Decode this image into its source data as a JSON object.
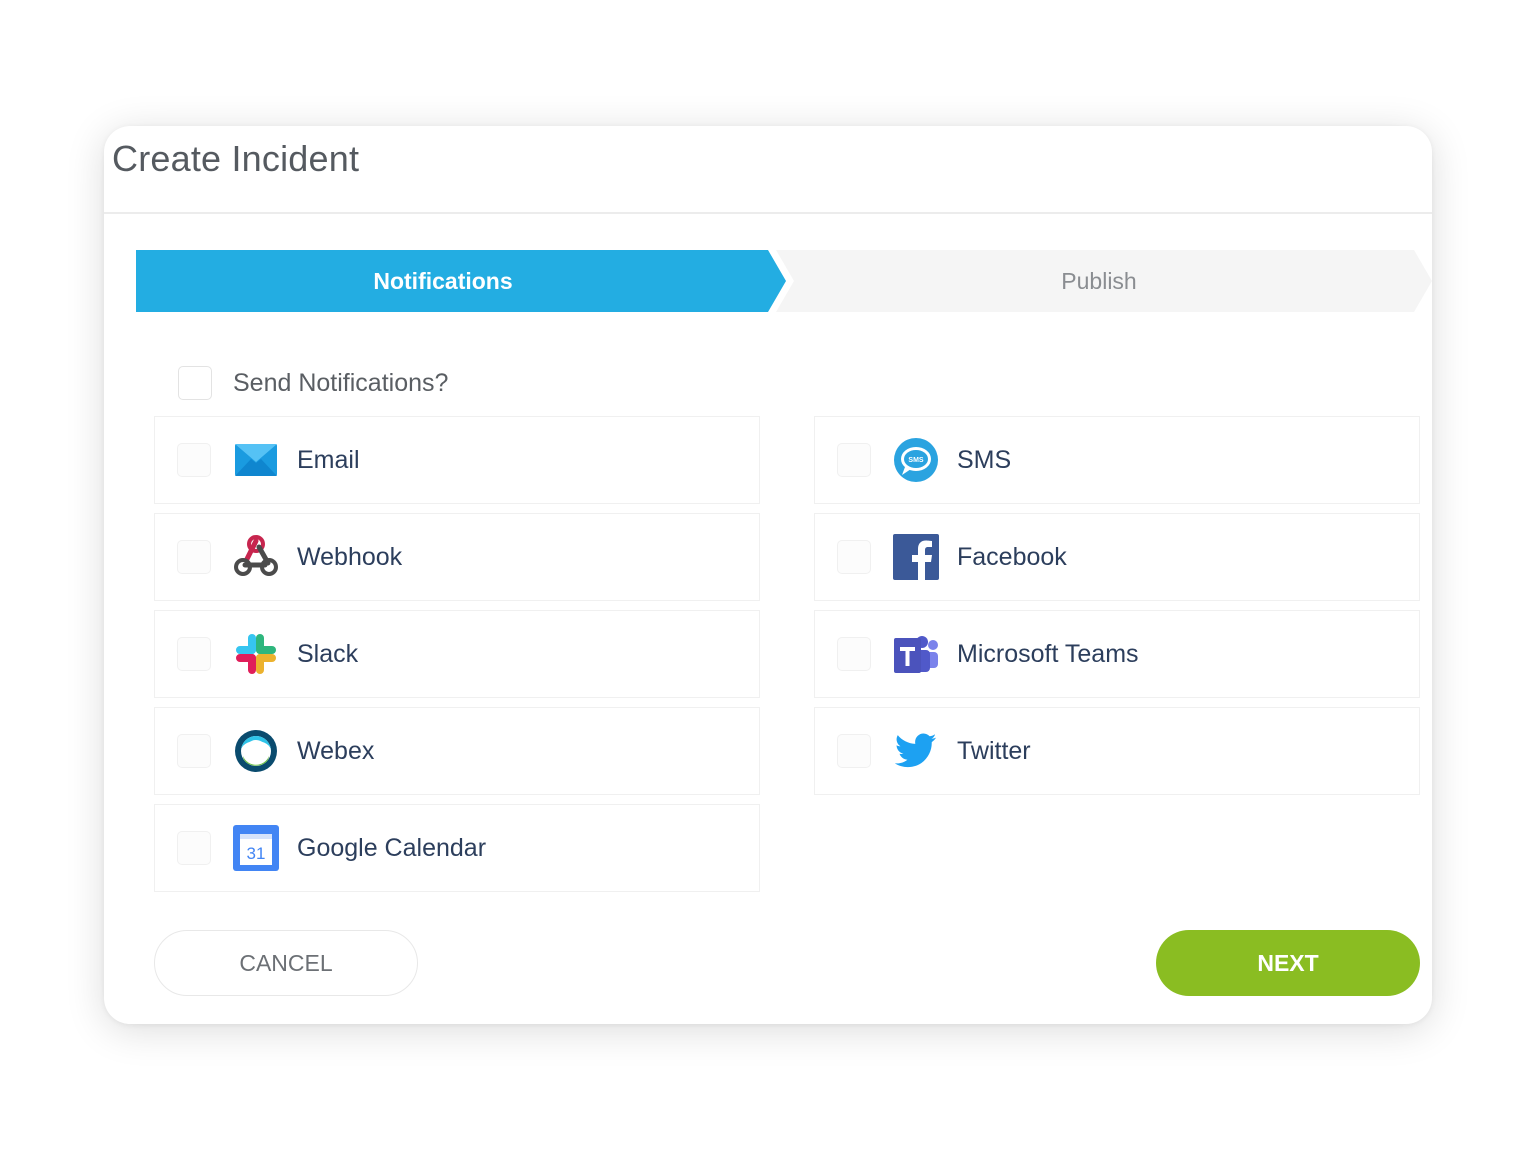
{
  "dialog": {
    "title": "Create Incident"
  },
  "stepper": {
    "steps": [
      {
        "label": "Notifications",
        "active": true
      },
      {
        "label": "Publish",
        "active": false
      }
    ],
    "active_color": "#23ade2"
  },
  "send_notifications": {
    "label": "Send Notifications?",
    "checked": false
  },
  "channels": [
    {
      "label": "Email",
      "icon": "email-icon",
      "checked": false
    },
    {
      "label": "SMS",
      "icon": "sms-icon",
      "checked": false
    },
    {
      "label": "Webhook",
      "icon": "webhook-icon",
      "checked": false
    },
    {
      "label": "Facebook",
      "icon": "facebook-icon",
      "checked": false
    },
    {
      "label": "Slack",
      "icon": "slack-icon",
      "checked": false
    },
    {
      "label": "Microsoft Teams",
      "icon": "microsoft-teams-icon",
      "checked": false
    },
    {
      "label": "Webex",
      "icon": "webex-icon",
      "checked": false
    },
    {
      "label": "Twitter",
      "icon": "twitter-icon",
      "checked": false
    },
    {
      "label": "Google Calendar",
      "icon": "google-calendar-icon",
      "checked": false
    }
  ],
  "icon_text": {
    "sms": "SMS",
    "calendar_day": "31"
  },
  "footer": {
    "cancel_label": "CANCEL",
    "next_label": "NEXT",
    "next_color": "#8abd22"
  }
}
